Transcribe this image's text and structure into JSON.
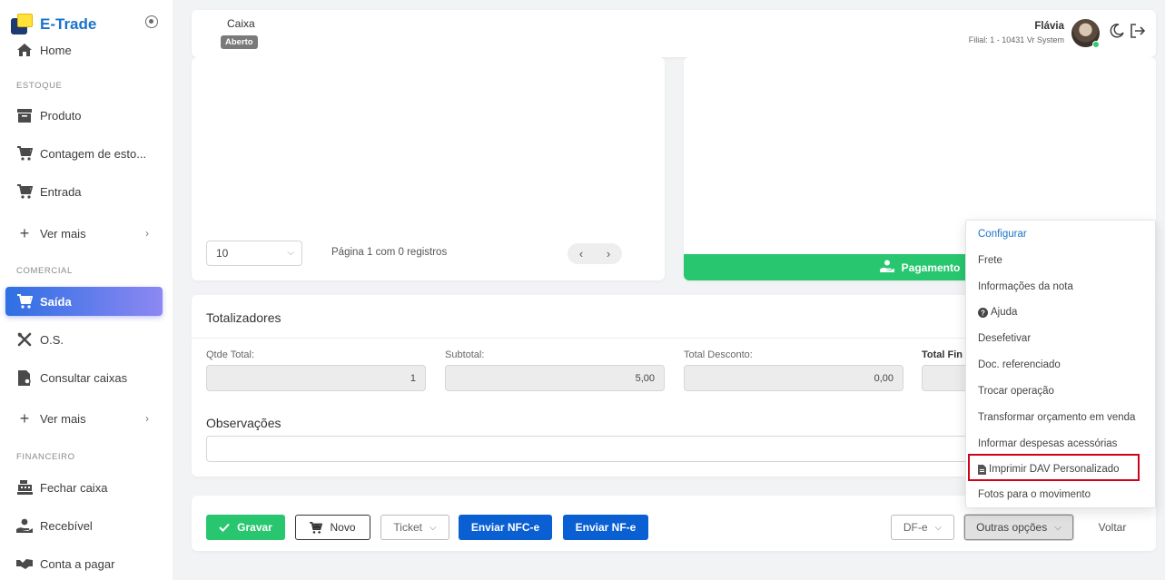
{
  "brand": {
    "name": "E-Trade"
  },
  "sidebar": {
    "home": "Home",
    "sections": {
      "estoque": "ESTOQUE",
      "comercial": "COMERCIAL",
      "financeiro": "FINANCEIRO"
    },
    "estoque_items": [
      "Produto",
      "Contagem de esto...",
      "Entrada",
      "Ver mais"
    ],
    "comercial_items": [
      "Saída",
      "O.S.",
      "Consultar caixas",
      "Ver mais"
    ],
    "financeiro_items": [
      "Fechar caixa",
      "Recebível",
      "Conta a pagar"
    ]
  },
  "header": {
    "title": "Caixa",
    "badge": "Aberto",
    "user_name": "Flávia",
    "branch": "Filial: 1 - 10431 Vr System"
  },
  "grid": {
    "page_size": "10",
    "page_info": "Página 1 com 0 registros",
    "prev": "‹",
    "next": "›"
  },
  "payment": {
    "label": "Pagamento"
  },
  "totals": {
    "title": "Totalizadores",
    "qtde_label": "Qtde Total:",
    "qtde_value": "1",
    "subtotal_label": "Subtotal:",
    "subtotal_value": "5,00",
    "desconto_label": "Total Desconto:",
    "desconto_value": "0,00",
    "final_label": "Total Fin",
    "obs_title": "Observações"
  },
  "footer": {
    "gravar": "Gravar",
    "novo": "Novo",
    "ticket": "Ticket",
    "enviar_nfce": "Enviar NFC-e",
    "enviar_nfe": "Enviar NF-e",
    "dfe": "DF-e",
    "outras": "Outras opções",
    "voltar": "Voltar"
  },
  "dropdown": {
    "items": [
      "Configurar",
      "Frete",
      "Informações da nota",
      "Ajuda",
      "Desefetivar",
      "Doc. referenciado",
      "Trocar operação",
      "Transformar orçamento em venda",
      "Informar despesas acessórias",
      "Imprimir DAV Personalizado",
      "Fotos para o movimento"
    ]
  },
  "colors": {
    "accent_blue": "#0a5fd2",
    "success_green": "#28c76f",
    "highlight_red": "#d0021b"
  }
}
